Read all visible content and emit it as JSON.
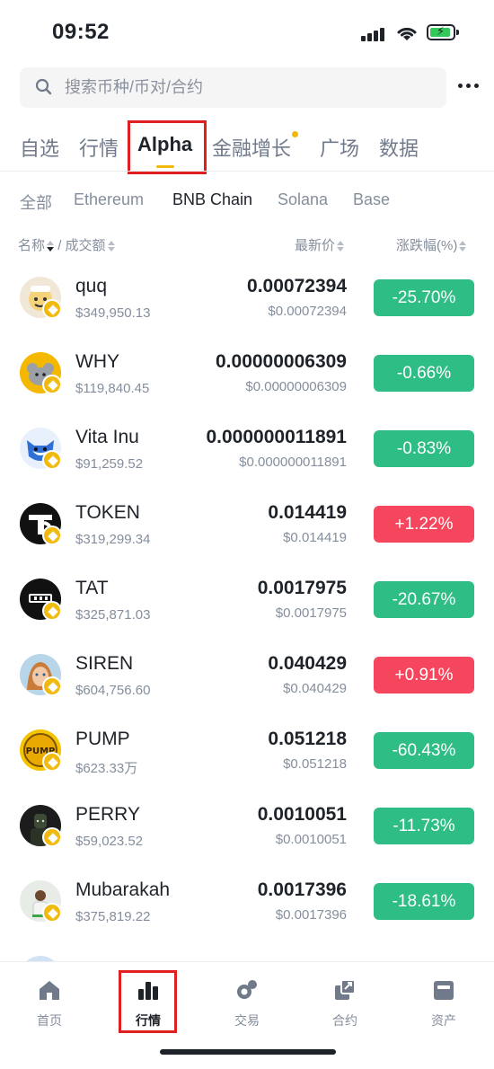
{
  "status_bar": {
    "time": "09:52"
  },
  "search": {
    "placeholder": "搜索币种/币对/合约"
  },
  "tabs": [
    {
      "label": "自选"
    },
    {
      "label": "行情"
    },
    {
      "label": "Alpha"
    },
    {
      "label": "金融增长"
    },
    {
      "label": "广场"
    },
    {
      "label": "数据"
    }
  ],
  "chains": [
    {
      "label": "全部"
    },
    {
      "label": "Ethereum"
    },
    {
      "label": "BNB Chain"
    },
    {
      "label": "Solana"
    },
    {
      "label": "Base"
    }
  ],
  "columns": {
    "name": "名称",
    "separator": "/",
    "volume": "成交额",
    "price": "最新价",
    "change": "涨跌幅(%)"
  },
  "rows": [
    {
      "name": "quq",
      "volume": "$349,950.13",
      "price": "0.00072394",
      "usd": "$0.00072394",
      "change": "-25.70%",
      "direction": "down"
    },
    {
      "name": "WHY",
      "volume": "$119,840.45",
      "price": "0.00000006309",
      "usd": "$0.00000006309",
      "change": "-0.66%",
      "direction": "down"
    },
    {
      "name": "Vita Inu",
      "volume": "$91,259.52",
      "price": "0.000000011891",
      "usd": "$0.000000011891",
      "change": "-0.83%",
      "direction": "down"
    },
    {
      "name": "TOKEN",
      "volume": "$319,299.34",
      "price": "0.014419",
      "usd": "$0.014419",
      "change": "+1.22%",
      "direction": "up"
    },
    {
      "name": "TAT",
      "volume": "$325,871.03",
      "price": "0.0017975",
      "usd": "$0.0017975",
      "change": "-20.67%",
      "direction": "down"
    },
    {
      "name": "SIREN",
      "volume": "$604,756.60",
      "price": "0.040429",
      "usd": "$0.040429",
      "change": "+0.91%",
      "direction": "up"
    },
    {
      "name": "PUMP",
      "volume": "$623.33万",
      "price": "0.051218",
      "usd": "$0.051218",
      "change": "-60.43%",
      "direction": "down"
    },
    {
      "name": "PERRY",
      "volume": "$59,023.52",
      "price": "0.0010051",
      "usd": "$0.0010051",
      "change": "-11.73%",
      "direction": "down"
    },
    {
      "name": "Mubarakah",
      "volume": "$375,819.22",
      "price": "0.0017396",
      "usd": "$0.0017396",
      "change": "-18.61%",
      "direction": "down"
    }
  ],
  "bottom_nav": [
    {
      "label": "首页",
      "icon": "home-icon"
    },
    {
      "label": "行情",
      "icon": "markets-icon"
    },
    {
      "label": "交易",
      "icon": "trade-icon"
    },
    {
      "label": "合约",
      "icon": "futures-icon"
    },
    {
      "label": "资产",
      "icon": "wallet-icon"
    }
  ],
  "colors": {
    "up": "#f6465d",
    "down": "#2ebd85",
    "accent": "#f0b90b",
    "highlight": "#e02020"
  }
}
